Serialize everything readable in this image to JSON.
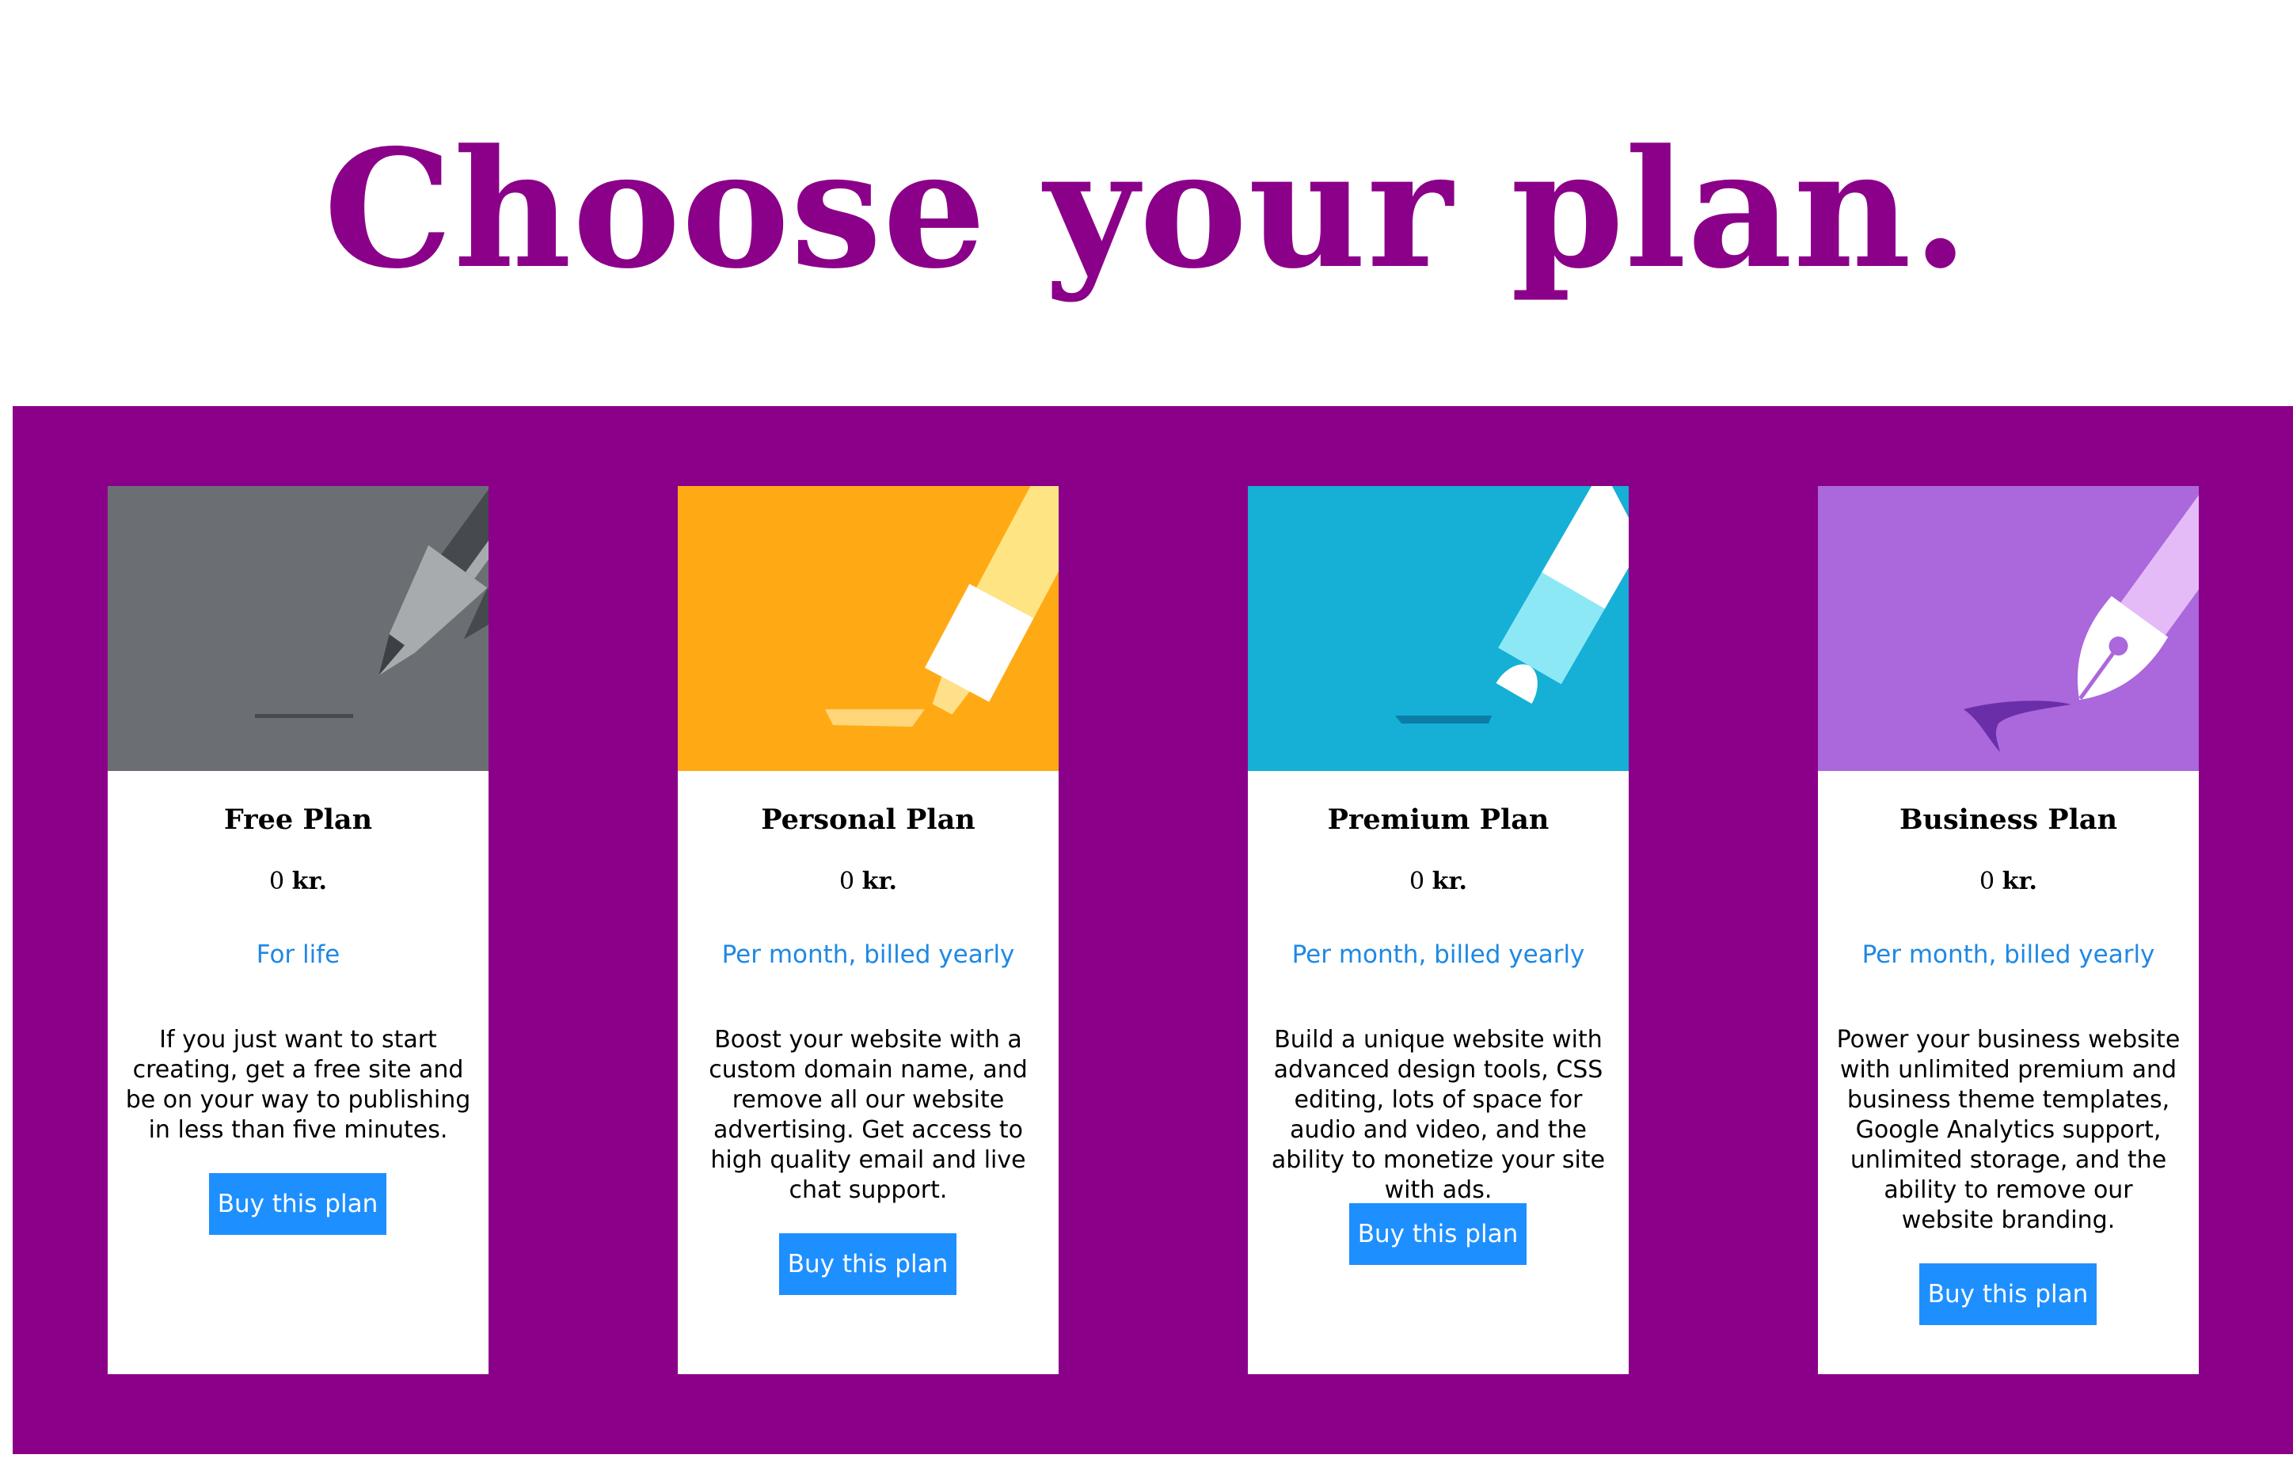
{
  "page": {
    "title": "Choose your plan."
  },
  "colors": {
    "accent": "#8b0089",
    "button": "#1e8fff",
    "link": "#1e88e5"
  },
  "plans": [
    {
      "name": "Free Plan",
      "price_amount": "0",
      "price_currency": "kr.",
      "period": "For life",
      "description": "If you just want to start creating, get a free site and be on your way to publishing in less than five minutes.",
      "button_label": "Buy this plan",
      "art_color": "#6b6f74",
      "icon": "ink-pen-icon"
    },
    {
      "name": "Personal Plan",
      "price_amount": "0",
      "price_currency": "kr.",
      "period": "Per month, billed yearly",
      "description": "Boost your website with a custom domain name, and remove all our website advertising. Get access to high quality email and live chat support.",
      "button_label": "Buy this plan",
      "art_color": "#ffaa15",
      "icon": "highlighter-icon"
    },
    {
      "name": "Premium Plan",
      "price_amount": "0",
      "price_currency": "kr.",
      "period": "Per month, billed yearly",
      "description": "Build a unique website with advanced design tools, CSS editing, lots of space for audio and video, and the ability to monetize your site with ads.",
      "button_label": "Buy this plan",
      "art_color": "#16afd6",
      "icon": "marker-icon"
    },
    {
      "name": "Business Plan",
      "price_amount": "0",
      "price_currency": "kr.",
      "period": "Per month, billed yearly",
      "description": "Power your business website with unlimited premium and business theme templates, Google Analytics support, unlimited storage, and the ability to remove our website branding.",
      "button_label": "Buy this plan",
      "art_color": "#ab67dc",
      "icon": "fountain-pen-icon"
    }
  ]
}
